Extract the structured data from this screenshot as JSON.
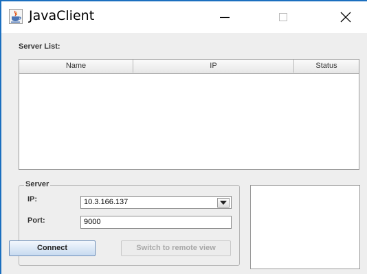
{
  "window": {
    "title": "JavaClient"
  },
  "server_list": {
    "label": "Server List:",
    "columns": [
      "Name",
      "IP",
      "Status"
    ],
    "rows": []
  },
  "server_group": {
    "title": "Server",
    "ip_label": "IP:",
    "ip_value": "10.3.166.137",
    "port_label": "Port:",
    "port_value": "9000",
    "connect_label": "Connect",
    "switch_label": "Switch to remote view"
  },
  "colors": {
    "accent": "#1b6fbf",
    "connect_button": "#c7daf0"
  },
  "icons": [
    "java-cup-icon",
    "minimize-icon",
    "maximize-icon",
    "close-icon",
    "chevron-down-icon"
  ]
}
